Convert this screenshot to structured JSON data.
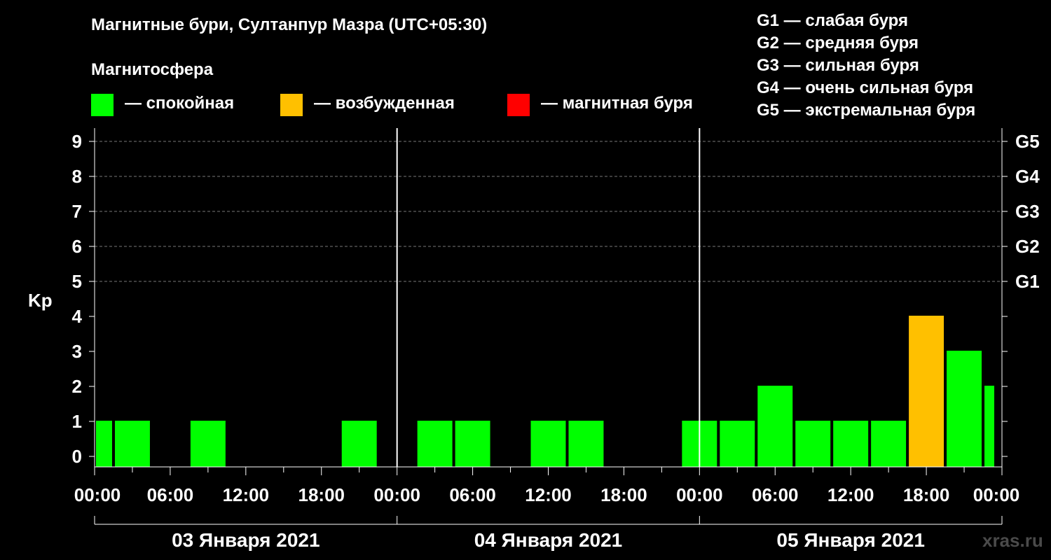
{
  "title": "Магнитные бури, Султанпур Мазра (UTC+05:30)",
  "magnetosphere": {
    "title": "Магнитосфера",
    "legend": [
      {
        "label": "— спокойная",
        "color": "#00ff00"
      },
      {
        "label": "— возбужденная",
        "color": "#ffc000"
      },
      {
        "label": "— магнитная буря",
        "color": "#ff0000"
      }
    ]
  },
  "g_scale_legend": [
    "G1 — слабая буря",
    "G2 — средняя буря",
    "G3 — сильная буря",
    "G4 — очень сильная буря",
    "G5 — экстремальная буря"
  ],
  "watermark": "xras.ru",
  "chart_data": {
    "type": "bar",
    "ylabel": "Kp",
    "ylim": [
      0,
      9
    ],
    "yticks": [
      "0",
      "1",
      "2",
      "3",
      "4",
      "5",
      "6",
      "7",
      "8",
      "9"
    ],
    "right_ticks": [
      {
        "kp": 5,
        "label": "G1"
      },
      {
        "kp": 6,
        "label": "G2"
      },
      {
        "kp": 7,
        "label": "G3"
      },
      {
        "kp": 8,
        "label": "G4"
      },
      {
        "kp": 9,
        "label": "G5"
      }
    ],
    "grid": "dashed horizontal lines at Kp 5–9",
    "x_tick_labels": [
      "00:00",
      "06:00",
      "12:00",
      "18:00",
      "00:00",
      "06:00",
      "12:00",
      "18:00",
      "00:00",
      "06:00",
      "12:00",
      "18:00",
      "00:00"
    ],
    "days": [
      "03 Января 2021",
      "04 Января 2021",
      "05 Января 2021"
    ],
    "x_unit": "hours from 03 Января 2021 00:00",
    "bars": [
      {
        "start": 0,
        "end": 1.5,
        "kp": 1,
        "level": "спокойная"
      },
      {
        "start": 1.5,
        "end": 4.5,
        "kp": 1,
        "level": "спокойная"
      },
      {
        "start": 7.5,
        "end": 10.5,
        "kp": 1,
        "level": "спокойная"
      },
      {
        "start": 19.5,
        "end": 22.5,
        "kp": 1,
        "level": "спокойная"
      },
      {
        "start": 25.5,
        "end": 28.5,
        "kp": 1,
        "level": "спокойная"
      },
      {
        "start": 28.5,
        "end": 31.5,
        "kp": 1,
        "level": "спокойная"
      },
      {
        "start": 34.5,
        "end": 37.5,
        "kp": 1,
        "level": "спокойная"
      },
      {
        "start": 37.5,
        "end": 40.5,
        "kp": 1,
        "level": "спокойная"
      },
      {
        "start": 46.5,
        "end": 49.5,
        "kp": 1,
        "level": "спокойная"
      },
      {
        "start": 49.5,
        "end": 52.5,
        "kp": 1,
        "level": "спокойная"
      },
      {
        "start": 52.5,
        "end": 55.5,
        "kp": 2,
        "level": "спокойная"
      },
      {
        "start": 55.5,
        "end": 58.5,
        "kp": 1,
        "level": "спокойная"
      },
      {
        "start": 58.5,
        "end": 61.5,
        "kp": 1,
        "level": "спокойная"
      },
      {
        "start": 61.5,
        "end": 64.5,
        "kp": 1,
        "level": "спокойная"
      },
      {
        "start": 64.5,
        "end": 67.5,
        "kp": 4,
        "level": "возбужденная"
      },
      {
        "start": 67.5,
        "end": 70.5,
        "kp": 3,
        "level": "спокойная"
      },
      {
        "start": 70.5,
        "end": 71.5,
        "kp": 2,
        "level": "спокойная"
      }
    ]
  }
}
